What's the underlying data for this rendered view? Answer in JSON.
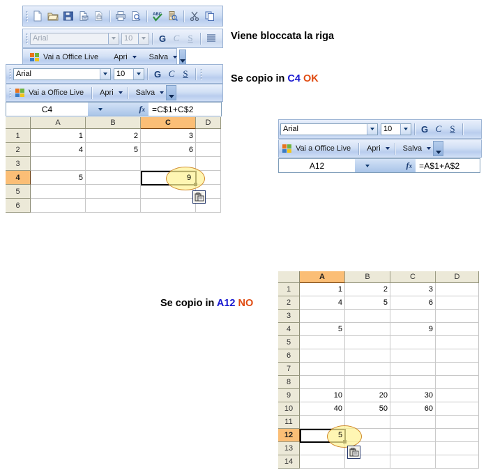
{
  "annotations": {
    "locked_row": "Viene bloccata la riga",
    "copy_ok_prefix": "Se copio in",
    "copy_ok_ref": "C4",
    "copy_ok_verdict": "OK",
    "copy_no_prefix": "Se copio in",
    "copy_no_ref": "A12",
    "copy_no_verdict": "NO"
  },
  "colors": {
    "reference_blue": "#1818d0",
    "verdict_orange": "#e04a10",
    "header_selected": "#fbbe76",
    "highlight_yellow": "#fff396",
    "highlight_outline": "#d08a2e"
  },
  "standard_toolbar": {
    "buttons": [
      {
        "name": "new-document-icon",
        "label": "Nuovo"
      },
      {
        "name": "open-folder-icon",
        "label": "Apri"
      },
      {
        "name": "save-disk-icon",
        "label": "Salva"
      },
      {
        "name": "email-icon",
        "label": "Posta elettronica"
      },
      {
        "name": "permission-icon",
        "label": "Autorizzazione"
      },
      {
        "name": "print-icon",
        "label": "Stampa"
      },
      {
        "name": "print-preview-icon",
        "label": "Anteprima di stampa"
      },
      {
        "name": "spellcheck-icon",
        "label": "Controllo ortografia"
      },
      {
        "name": "research-icon",
        "label": "Ricerca"
      },
      {
        "name": "cut-scissors-icon",
        "label": "Taglia"
      },
      {
        "name": "copy-icon",
        "label": "Copia"
      }
    ]
  },
  "formatting_toolbar_back": {
    "font_name": "Arial",
    "font_size": "10",
    "bold_label": "G",
    "italic_label": "C",
    "underline_label": "S",
    "align_label": "Allineamento",
    "enabled": false
  },
  "formatting_toolbar_front": {
    "font_name": "Arial",
    "font_size": "10",
    "bold_label": "G",
    "italic_label": "C",
    "underline_label": "S",
    "enabled": true
  },
  "office_live_toolbar": {
    "logo_name": "office-live-logo-icon",
    "go_label": "Vai a Office Live",
    "open_label": "Apri",
    "save_label": "Salva",
    "overflow_label": "Altri pulsanti"
  },
  "sheet_left": {
    "formula_bar": {
      "name_box": "C4",
      "fx_label": "fx",
      "formula": "=C$1+C$2"
    },
    "columns": [
      "A",
      "B",
      "C",
      "D"
    ],
    "selected_column": "C",
    "rows": [
      "1",
      "2",
      "3",
      "4",
      "5",
      "6"
    ],
    "selected_row": "4",
    "cells": [
      [
        "1",
        "2",
        "3",
        ""
      ],
      [
        "4",
        "5",
        "6",
        ""
      ],
      [
        "",
        "",
        "",
        ""
      ],
      [
        "5",
        "",
        "",
        ""
      ],
      [
        "",
        "",
        "",
        ""
      ],
      [
        "",
        "",
        "",
        ""
      ]
    ],
    "active_cell": "C4",
    "active_cell_value": "9",
    "paste_options_icon": "paste-options-clipboard-icon"
  },
  "sheet_right": {
    "formatting_toolbar": {
      "font_name": "Arial",
      "font_size": "10",
      "bold_label": "G",
      "italic_label": "C",
      "underline_label": "S"
    },
    "office_live_toolbar": {
      "go_label": "Vai a Office Live",
      "open_label": "Apri",
      "save_label": "Salva"
    },
    "formula_bar": {
      "name_box": "A12",
      "fx_label": "fx",
      "formula": "=A$1+A$2"
    },
    "columns": [
      "A",
      "B",
      "C",
      "D"
    ],
    "selected_column": "A",
    "rows": [
      "1",
      "2",
      "3",
      "4",
      "5",
      "6",
      "7",
      "8",
      "9",
      "10",
      "11",
      "12",
      "13",
      "14"
    ],
    "selected_row": "12",
    "cells": [
      [
        "1",
        "2",
        "3",
        ""
      ],
      [
        "4",
        "5",
        "6",
        ""
      ],
      [
        "",
        "",
        "",
        ""
      ],
      [
        "5",
        "",
        "9",
        ""
      ],
      [
        "",
        "",
        "",
        ""
      ],
      [
        "",
        "",
        "",
        ""
      ],
      [
        "",
        "",
        "",
        ""
      ],
      [
        "",
        "",
        "",
        ""
      ],
      [
        "10",
        "20",
        "30",
        ""
      ],
      [
        "40",
        "50",
        "60",
        ""
      ],
      [
        "",
        "",
        "",
        ""
      ],
      [
        "",
        "",
        "",
        ""
      ],
      [
        "",
        "",
        "",
        ""
      ],
      [
        "",
        "",
        "",
        ""
      ]
    ],
    "active_cell": "A12",
    "active_cell_value": "5",
    "paste_options_icon": "paste-options-clipboard-icon"
  }
}
